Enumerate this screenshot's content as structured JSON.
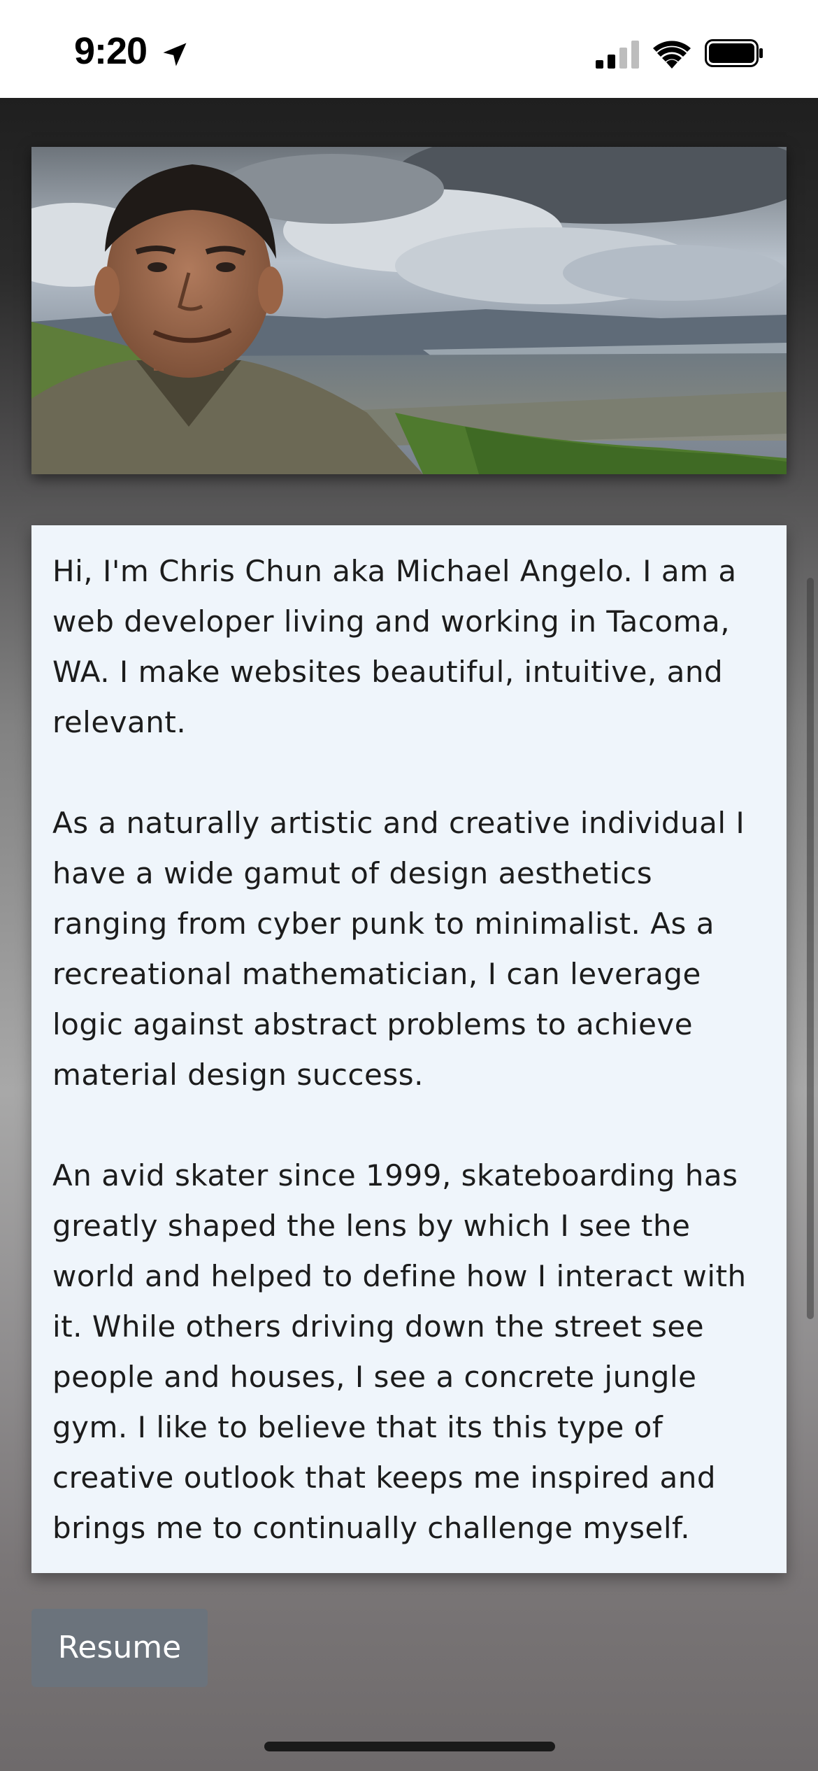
{
  "status_bar": {
    "time": "9:20"
  },
  "icons": {
    "location": "location-arrow-icon",
    "signal": "cellular-signal-icon",
    "wifi": "wifi-icon",
    "battery": "battery-icon"
  },
  "hero": {
    "alt": "Portrait of man on green hillside overlooking a city under clouds"
  },
  "bio": {
    "paragraphs": [
      "Hi, I'm Chris Chun aka Michael Angelo. I am a web developer living and working in Tacoma, WA. I make websites beautiful, intuitive, and relevant.",
      "As a naturally artistic and creative individual I have a wide gamut of design aesthetics ranging from cyber punk to minimalist. As a recreational mathematician, I can leverage logic against abstract problems to achieve material design success.",
      "An avid skater since 1999, skateboarding has greatly shaped the lens by which I see the world and helped to define how I interact with it. While others driving down the street see people and houses, I see a concrete jungle gym. I like to believe that its this type of creative outlook that keeps me inspired and brings me to continually challenge myself."
    ]
  },
  "resume_button": {
    "label": "Resume"
  },
  "colors": {
    "card_bg": "#eff5fb",
    "button_bg": "#6b737c",
    "text": "#1c1c1c"
  }
}
